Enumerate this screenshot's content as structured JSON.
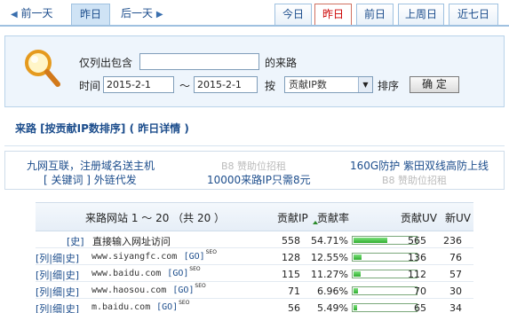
{
  "topnav": {
    "prev_label": "前一天",
    "current_label": "昨日",
    "next_label": "后一天",
    "tabs": [
      {
        "label": "今日",
        "active": false
      },
      {
        "label": "昨日",
        "active": true
      },
      {
        "label": "前日",
        "active": false
      },
      {
        "label": "上周日",
        "active": false
      },
      {
        "label": "近七日",
        "active": false
      }
    ]
  },
  "filter": {
    "contains_label": "仅列出包含",
    "contains_value": "",
    "source_suffix": "的来路",
    "time_label": "时间",
    "date_from": "2015-2-1",
    "range_sep": "～",
    "date_to": "2015-2-1",
    "by_label": "按",
    "sort_value": "贡献IP数",
    "order_label": "排序",
    "confirm_label": "确 定"
  },
  "section": {
    "title": "来路  [按贡献IP数排序] ( 昨日详情 )"
  },
  "ads": {
    "row1": [
      {
        "text": "九网互联，注册域名送主机",
        "type": "link"
      },
      {
        "text": "B8 赞助位招租",
        "type": "placeholder"
      },
      {
        "text": "160G防护 紫田双线高防上线",
        "type": "link"
      }
    ],
    "row2": [
      {
        "text": "[ 关键词 ] 外链代发",
        "type": "link"
      },
      {
        "text": "10000来路IP只需8元",
        "type": "link"
      },
      {
        "text": "B8 赞助位招租",
        "type": "placeholder"
      }
    ]
  },
  "table": {
    "headers": {
      "site": "来路网站 1 ～ 20 （共 20 ）",
      "ip": "贡献IP",
      "rate": "贡献率",
      "uv": "贡献UV",
      "newuv": "新UV"
    },
    "rows": [
      {
        "prefix": "[史]",
        "site": "直接输入网址访问",
        "go": "",
        "seo": "",
        "ip": "558",
        "rate": "54.71%",
        "rate_value": 54.71,
        "uv": "565",
        "newuv": "236"
      },
      {
        "prefix": "[列|细|史]",
        "site": "www.siyangfc.com",
        "go": "[GO]",
        "seo": "SEO",
        "ip": "128",
        "rate": "12.55%",
        "rate_value": 12.55,
        "uv": "136",
        "newuv": "76"
      },
      {
        "prefix": "[列|细|史]",
        "site": "www.baidu.com",
        "go": "[GO]",
        "seo": "SEO",
        "ip": "115",
        "rate": "11.27%",
        "rate_value": 11.27,
        "uv": "112",
        "newuv": "57"
      },
      {
        "prefix": "[列|细|史]",
        "site": "www.haosou.com",
        "go": "[GO]",
        "seo": "SEO",
        "ip": "71",
        "rate": "6.96%",
        "rate_value": 6.96,
        "uv": "70",
        "newuv": "30"
      },
      {
        "prefix": "[列|细|史]",
        "site": "m.baidu.com",
        "go": "[GO]",
        "seo": "SEO",
        "ip": "56",
        "rate": "5.49%",
        "rate_value": 5.49,
        "uv": "65",
        "newuv": "34"
      }
    ]
  },
  "colors": {
    "link": "#1c4d8c",
    "active_tab_text": "#cc0000",
    "bar_fill": "#2fae2f",
    "panel_bg": "#eef5fc"
  }
}
